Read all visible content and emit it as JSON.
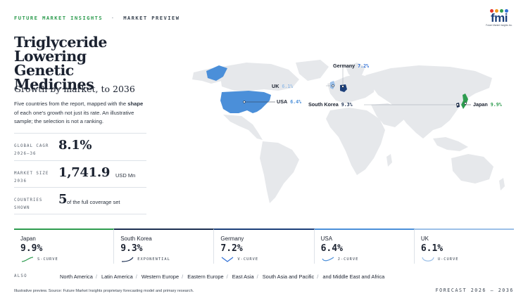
{
  "header": {
    "brand": "FUTURE MARKET INSIGHTS",
    "separator": "·",
    "section": "MARKET PREVIEW",
    "logo_text": "fmi",
    "logo_tagline": "Future Market Insights Inc."
  },
  "title": "Triglyceride Lowering Genetic Medicines",
  "subtitle": "Growth by market, to 2036",
  "description": {
    "part1": "Five countries from the report, mapped with the ",
    "bold": "shape",
    "part2": " of each one's growth not just its rate. An illustrative sample; the selection is not a ranking."
  },
  "stats": [
    {
      "label": "GLOBAL CAGR 2026–36",
      "value": "8.1%",
      "unit": ""
    },
    {
      "label": "MARKET SIZE 2036",
      "value": "1,741.9",
      "unit": "USD Mn"
    },
    {
      "label": "COUNTRIES SHOWN",
      "value": "5",
      "unit": "of the full coverage set"
    }
  ],
  "map_labels": {
    "germany": {
      "name": "Germany",
      "pct": "7.2%"
    },
    "uk": {
      "name": "UK",
      "pct": "6.1%"
    },
    "usa": {
      "name": "USA",
      "pct": "6.4%"
    },
    "south_korea": {
      "name": "South Korea",
      "pct": "9.3%"
    },
    "japan": {
      "name": "Japan",
      "pct": "9.9%"
    }
  },
  "cards": [
    {
      "country": "Japan",
      "pct": "9.9%",
      "shape": "S-CURVE",
      "color": "#2e9c4f"
    },
    {
      "country": "South Korea",
      "pct": "9.3%",
      "shape": "EXPONENTIAL",
      "color": "#1c2f52"
    },
    {
      "country": "Germany",
      "pct": "7.2%",
      "shape": "V-CURVE",
      "color": "#2f6fd6"
    },
    {
      "country": "USA",
      "pct": "6.4%",
      "shape": "J-CURVE",
      "color": "#4b8fd9"
    },
    {
      "country": "UK",
      "pct": "6.1%",
      "shape": "U-CURVE",
      "color": "#9cc0e8"
    }
  ],
  "also": {
    "label": "ALSO",
    "regions": [
      "North America",
      "Latin America",
      "Western Europe",
      "Eastern Europe",
      "East Asia",
      "South Asia and Pacific",
      "and Middle East and Africa"
    ]
  },
  "footnote": "Illustrative preview. Source: Future Market Insights proprietary forecasting model and primary research.",
  "forecast": "FORECAST 2026 – 2036",
  "colors": {
    "land": "#e6e8eb",
    "usa": "#4b8fd9",
    "germany": "#1c3f7a",
    "uk": "#9cc0e8",
    "japan": "#2e9c4f",
    "south_korea": "#1c2f52"
  }
}
